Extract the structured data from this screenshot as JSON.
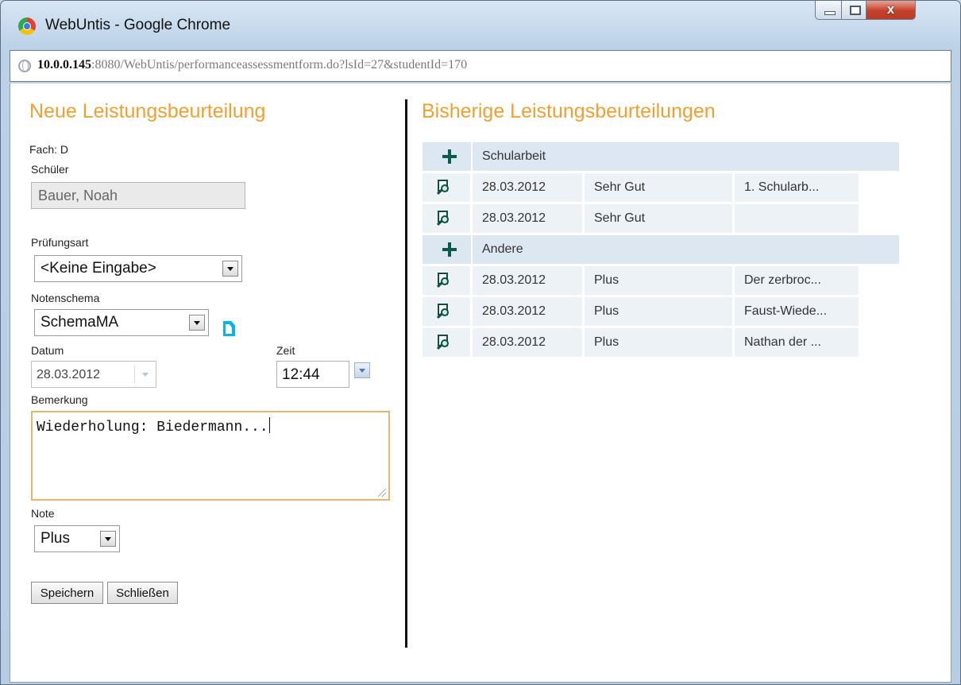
{
  "window": {
    "title": "WebUntis - Google Chrome",
    "close_glyph": "x"
  },
  "address": {
    "host": "10.0.0.145",
    "rest": ":8080/WebUntis/performanceassessmentform.do?lsId=27&studentId=170"
  },
  "form": {
    "heading": "Neue Leistungsbeurteilung",
    "subject": "Fach: D",
    "student_label": "Schüler",
    "student_value": "Bauer, Noah",
    "exam_type_label": "Prüfungsart",
    "exam_type_value": "<Keine Eingabe>",
    "scheme_label": "Notenschema",
    "scheme_value": "SchemaMA",
    "date_label": "Datum",
    "date_value": "28.03.2012",
    "time_label": "Zeit",
    "time_value": "12:44",
    "remark_label": "Bemerkung",
    "remark_value": "Wiederholung: Biedermann...",
    "grade_label": "Note",
    "grade_value": "Plus",
    "save_label": "Speichern",
    "close_label": "Schließen"
  },
  "history": {
    "heading": "Bisherige Leistungsbeurteilungen",
    "groups": [
      {
        "name": "Schularbeit",
        "rows": [
          {
            "date": "28.03.2012",
            "grade": "Sehr Gut",
            "note": "1. Schularb..."
          },
          {
            "date": "28.03.2012",
            "grade": "Sehr Gut",
            "note": ""
          }
        ]
      },
      {
        "name": "Andere",
        "rows": [
          {
            "date": "28.03.2012",
            "grade": "Plus",
            "note": "Der zerbroc..."
          },
          {
            "date": "28.03.2012",
            "grade": "Plus",
            "note": "Faust-Wiede..."
          },
          {
            "date": "28.03.2012",
            "grade": "Plus",
            "note": "Nathan der ..."
          }
        ]
      }
    ]
  },
  "colors": {
    "heading_orange": "#f0a030",
    "icon_green": "#0a5b49",
    "row_bg": "#edf2f7",
    "group_bg": "#dde7f1"
  },
  "icons": [
    "chrome-logo",
    "minimize-icon",
    "maximize-icon",
    "close-icon",
    "globe-icon",
    "dropdown-arrow-icon",
    "new-document-icon",
    "plus-icon",
    "search-document-icon",
    "resize-grip-icon"
  ]
}
